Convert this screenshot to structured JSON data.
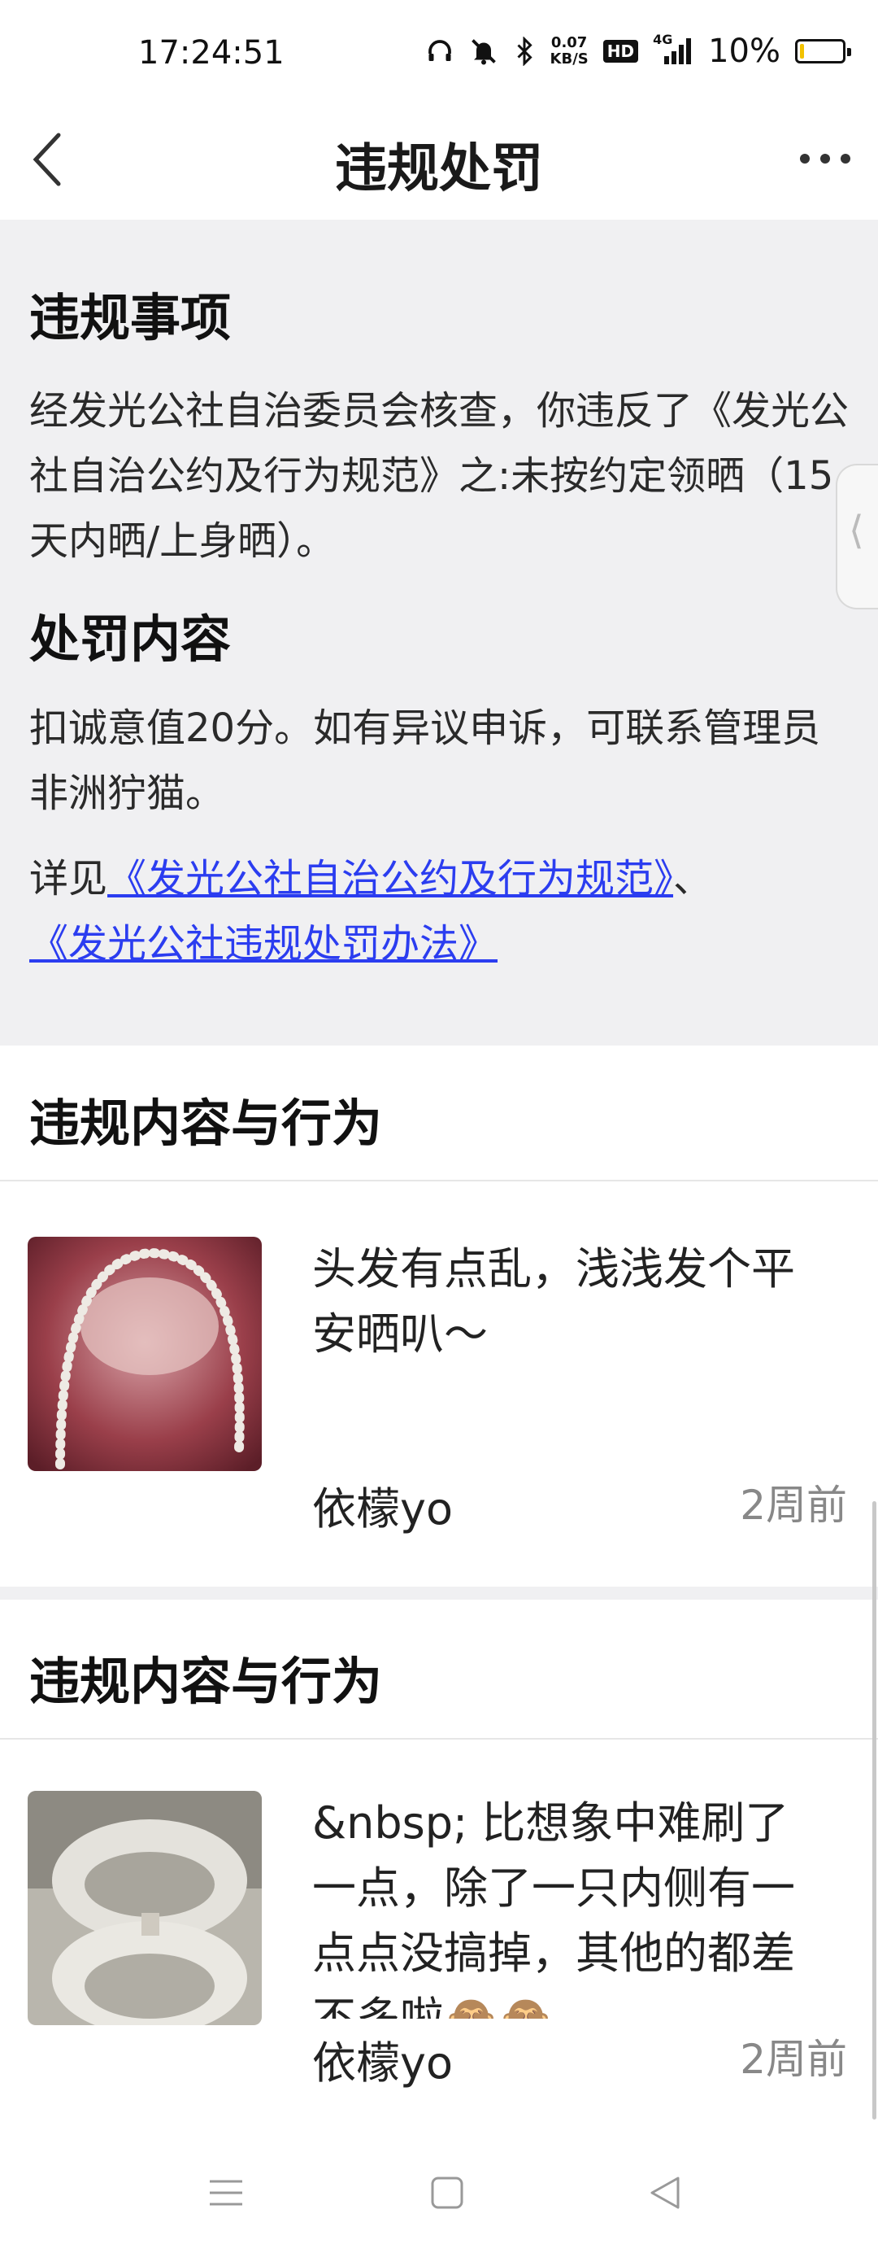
{
  "status_bar": {
    "time": "17:24:51",
    "speed_value": "0.07",
    "speed_unit": "KB/S",
    "hd": "HD",
    "network": "4G",
    "battery_text": "10%",
    "battery_level": 0.1,
    "icons": [
      "headphones-icon",
      "mute-bell-icon",
      "bluetooth-icon",
      "signal-icon",
      "battery-icon"
    ]
  },
  "header": {
    "title": "违规处罚"
  },
  "violation": {
    "heading": "违规事项",
    "text": "经发光公社自治委员会核查，你违反了《发光公社自治公约及行为规范》之:未按约定领晒（15天内晒/上身晒）。"
  },
  "penalty": {
    "heading": "处罚内容",
    "text": "扣诚意值20分。如有异议申诉，可联系管理员非洲狞猫。",
    "see_prefix": "详见",
    "link1": "《发光公社自治公约及行为规范》",
    "separator": "、",
    "link2": "《发光公社违规处罚办法》"
  },
  "cards": [
    {
      "heading": "违规内容与行为",
      "text": "头发有点乱，浅浅发个平安晒叭～",
      "author": "依檬yo",
      "time": "2周前"
    },
    {
      "heading": "违规内容与行为",
      "text": "&nbsp; 比想象中难刷了一点，除了一只内侧有一点点没搞掉，其他的都差不多啦🙈🙈",
      "author": "依檬yo",
      "time": "2周前"
    }
  ],
  "colors": {
    "accent_link": "#2b3df0",
    "section_bg": "#f0f0f2",
    "muted": "#888888"
  }
}
